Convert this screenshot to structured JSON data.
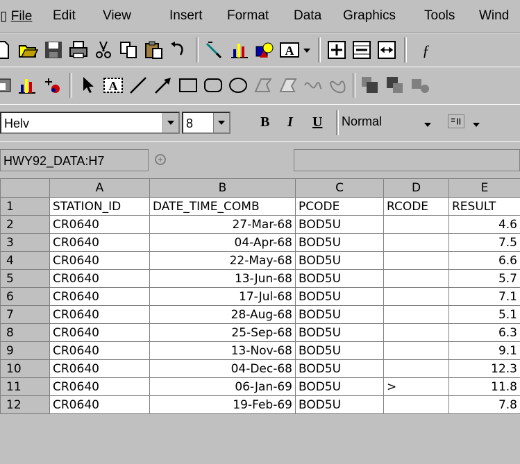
{
  "menu": [
    "File",
    "Edit",
    "View",
    "Insert",
    "Format",
    "Data",
    "Graphics",
    "Tools",
    "Wind"
  ],
  "font_toolbar": {
    "font_name": "Helv",
    "font_size": "8",
    "bold_label": "B",
    "italic_label": "I",
    "underline_label": "U",
    "style_name": "Normal"
  },
  "formula_bar": {
    "name_box": "HWY92_DATA:H7",
    "content": ""
  },
  "grid": {
    "columns": [
      "A",
      "B",
      "C",
      "D",
      "E"
    ],
    "rows": [
      {
        "n": "1",
        "a": "STATION_ID",
        "b": "DATE_TIME_COMB",
        "c": "PCODE",
        "d": "RCODE",
        "e": "RESULT"
      },
      {
        "n": "2",
        "a": "CR0640",
        "b": "27-Mar-68",
        "c": "BOD5U",
        "d": "",
        "e": "4.6"
      },
      {
        "n": "3",
        "a": "CR0640",
        "b": "04-Apr-68",
        "c": "BOD5U",
        "d": "",
        "e": "7.5"
      },
      {
        "n": "4",
        "a": "CR0640",
        "b": "22-May-68",
        "c": "BOD5U",
        "d": "",
        "e": "6.6"
      },
      {
        "n": "5",
        "a": "CR0640",
        "b": "13-Jun-68",
        "c": "BOD5U",
        "d": "",
        "e": "5.7"
      },
      {
        "n": "6",
        "a": "CR0640",
        "b": "17-Jul-68",
        "c": "BOD5U",
        "d": "",
        "e": "7.1"
      },
      {
        "n": "7",
        "a": "CR0640",
        "b": "28-Aug-68",
        "c": "BOD5U",
        "d": "",
        "e": "5.1"
      },
      {
        "n": "8",
        "a": "CR0640",
        "b": "25-Sep-68",
        "c": "BOD5U",
        "d": "",
        "e": "6.3"
      },
      {
        "n": "9",
        "a": "CR0640",
        "b": "13-Nov-68",
        "c": "BOD5U",
        "d": "",
        "e": "9.1"
      },
      {
        "n": "10",
        "a": "CR0640",
        "b": "04-Dec-68",
        "c": "BOD5U",
        "d": "",
        "e": "12.3"
      },
      {
        "n": "11",
        "a": "CR0640",
        "b": "06-Jan-69",
        "c": "BOD5U",
        "d": ">",
        "e": "11.8"
      },
      {
        "n": "12",
        "a": "CR0640",
        "b": "19-Feb-69",
        "c": "BOD5U",
        "d": "",
        "e": "7.8"
      }
    ]
  },
  "icons": {
    "toolbar1": [
      "new-doc-icon",
      "open-folder-icon",
      "save-icon",
      "print-icon",
      "cut-icon",
      "copy-icon",
      "paste-icon",
      "undo-icon",
      "format-painter-icon",
      "chart-wizard-icon",
      "drawing-icon",
      "text-box-icon",
      "dropdown-arrow-icon",
      "insert-row-icon",
      "delete-row-icon",
      "fit-column-icon",
      "function-icon"
    ],
    "toolbar2": [
      "record-icon",
      "chart-icon",
      "add-point-icon",
      "pointer-icon",
      "text-tool-icon",
      "line-icon",
      "arrow-icon",
      "rectangle-icon",
      "rounded-rect-icon",
      "ellipse-icon",
      "polygon-icon",
      "freeform-icon",
      "curve-icon",
      "closed-curve-icon",
      "bring-front-icon",
      "send-back-icon",
      "group-icon"
    ]
  },
  "colors": {
    "face": "#c0c0c0",
    "shadow": "#808080",
    "cell": "#ffffff"
  }
}
